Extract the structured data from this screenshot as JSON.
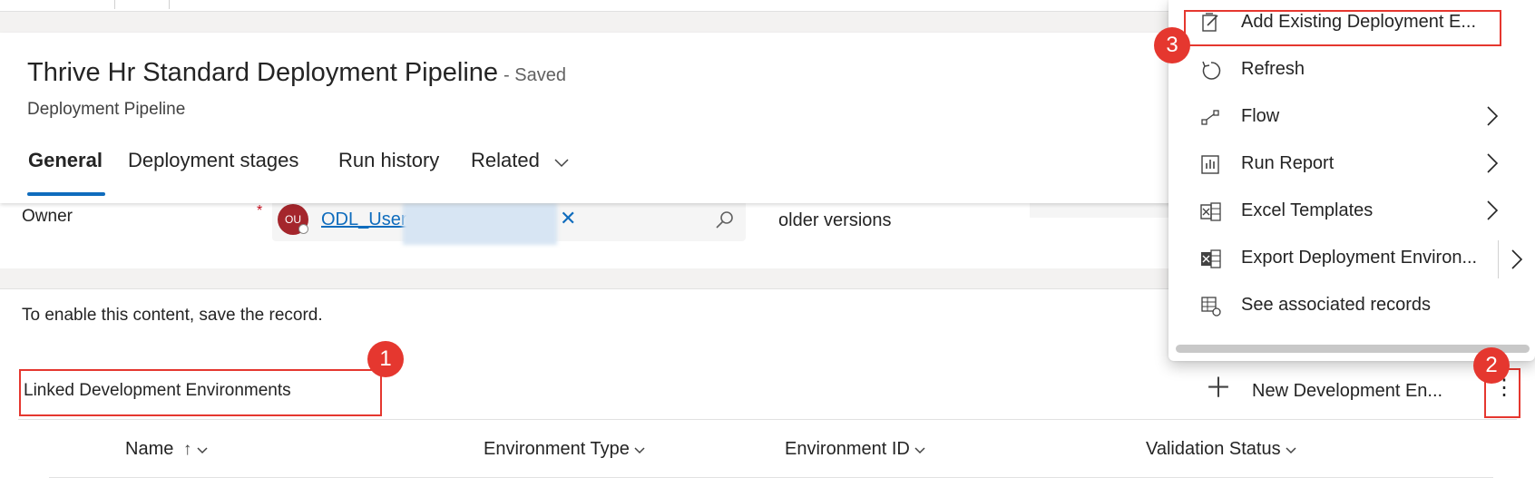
{
  "header": {
    "title": "Thrive Hr Standard Deployment Pipeline",
    "save_status": "- Saved",
    "entity": "Deployment Pipeline",
    "tabs": [
      {
        "label": "General",
        "active": true
      },
      {
        "label": "Deployment stages"
      },
      {
        "label": "Run history"
      },
      {
        "label": "Related"
      }
    ]
  },
  "form": {
    "owner_label": "Owner",
    "required_marker": "*",
    "owner_initials": "OU",
    "owner_name": "ODL_User",
    "clear_glyph": "✕",
    "older_versions_text": "older versions"
  },
  "subgrid": {
    "notice": "To enable this content, save the record.",
    "title": "Linked Development Environments",
    "new_button_label": "New Development En...",
    "more_glyph": "⋮",
    "columns": [
      {
        "label": "Name",
        "sort_glyph": "↑"
      },
      {
        "label": "Environment Type"
      },
      {
        "label": "Environment ID"
      },
      {
        "label": "Validation Status"
      }
    ]
  },
  "context_menu": {
    "items": [
      {
        "label": "Add Existing Deployment E...",
        "icon": "add-existing-icon"
      },
      {
        "label": "Refresh",
        "icon": "refresh-icon"
      },
      {
        "label": "Flow",
        "icon": "flow-icon",
        "submenu": true
      },
      {
        "label": "Run Report",
        "icon": "report-icon",
        "submenu": true
      },
      {
        "label": "Excel Templates",
        "icon": "excel-templates-icon",
        "submenu": true
      },
      {
        "label": "Export Deployment Environ...",
        "icon": "excel-export-icon",
        "submenu": true
      },
      {
        "label": "See associated records",
        "icon": "associated-records-icon"
      }
    ]
  },
  "annotations": {
    "badge1": "1",
    "badge2": "2",
    "badge3": "3"
  },
  "colors": {
    "accent": "#0f6cbd",
    "annotation_red": "#e5372f",
    "avatar": "#a4262c"
  }
}
